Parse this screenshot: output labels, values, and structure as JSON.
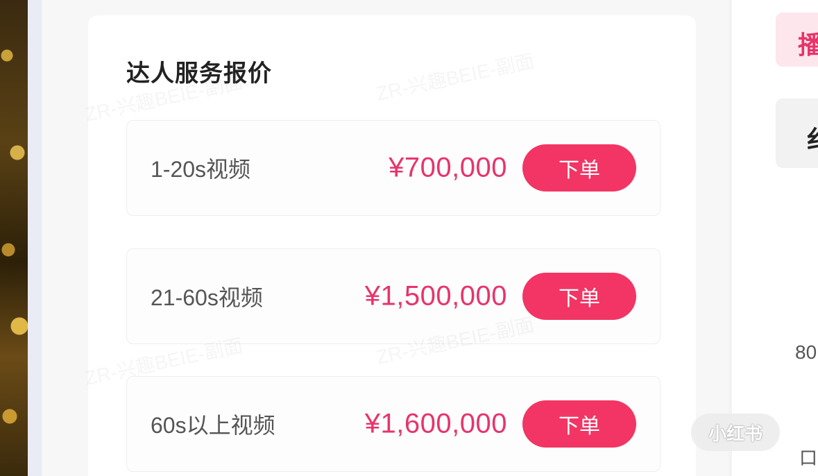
{
  "card": {
    "title": "达人服务报价"
  },
  "services": [
    {
      "label": "1-20s视频",
      "price": "¥700,000",
      "button": "下单"
    },
    {
      "label": "21-60s视频",
      "price": "¥1,500,000",
      "button": "下单"
    },
    {
      "label": "60s以上视频",
      "price": "¥1,600,000",
      "button": "下单"
    }
  ],
  "right_panel": {
    "tab_text": "播",
    "box_text": "纟",
    "number_text": "80",
    "bottom_text": "口"
  },
  "watermark": {
    "logo": "小红书",
    "text": "ZR-兴趣BEIE-副面"
  },
  "colors": {
    "accent": "#f23564",
    "price": "#e8336b",
    "title": "#222222"
  }
}
